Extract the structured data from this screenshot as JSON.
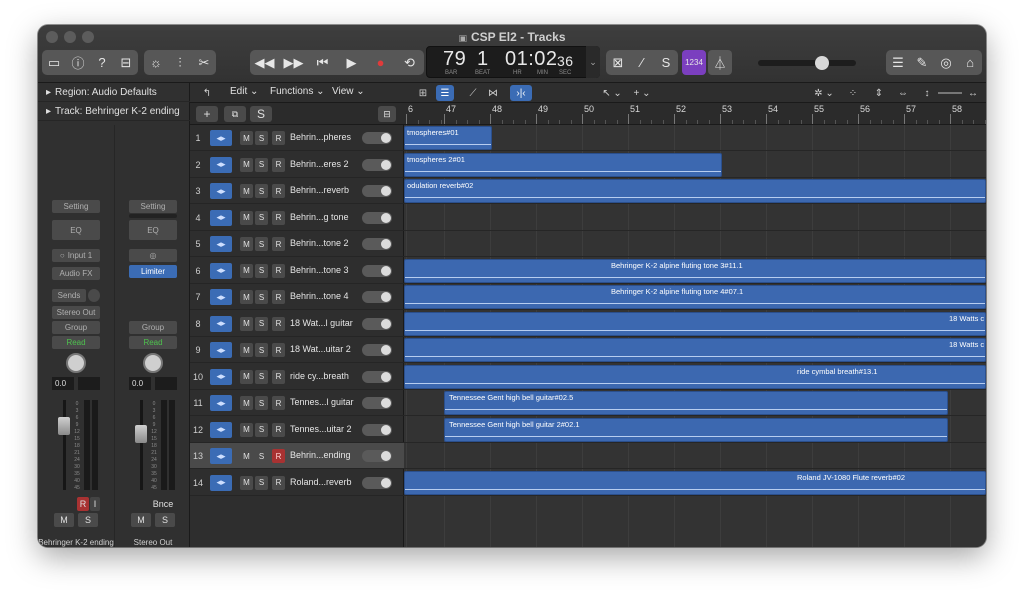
{
  "window": {
    "title": "CSP El2 - Tracks"
  },
  "lcd": {
    "bar": "79",
    "beat": "1",
    "time": "01:02",
    "sec": "36",
    "labels": [
      "BAR",
      "BEAT",
      "HR",
      "MIN",
      "SEC"
    ]
  },
  "key_badge": "1234",
  "inspector": {
    "region_label": "Region: Audio Defaults",
    "track_label": "Track:",
    "track_value": "Behringer K-2 ending",
    "strip1": {
      "setting": "Setting",
      "eq": "EQ",
      "input": "Input 1",
      "audio_fx": "Audio FX",
      "sends": "Sends",
      "output": "Stereo Out",
      "group": "Group",
      "automation": "Read",
      "pan_value": "0.0",
      "mute": "M",
      "solo": "S",
      "record": "R",
      "name": "Behringer K-2 ending"
    },
    "strip2": {
      "setting": "Setting",
      "eq": "EQ",
      "plugin": "Limiter",
      "group": "Group",
      "automation": "Read",
      "pan_value": "0.0",
      "bounce": "Bnce",
      "mute": "M",
      "solo": "S",
      "name": "Stereo Out"
    },
    "fader_scale": [
      "0",
      "3",
      "6",
      "9",
      "12",
      "15",
      "18",
      "21",
      "24",
      "30",
      "35",
      "40",
      "45",
      "50",
      "60"
    ]
  },
  "toolbar": {
    "edit": "Edit",
    "functions": "Functions",
    "view": "View"
  },
  "tracklist_header": {
    "add": "+",
    "solo_all": "S"
  },
  "tracks": [
    {
      "num": "1",
      "name": "Behrin...pheres",
      "mute": "M",
      "solo": "S",
      "record": "R"
    },
    {
      "num": "2",
      "name": "Behrin...eres 2",
      "mute": "M",
      "solo": "S",
      "record": "R"
    },
    {
      "num": "3",
      "name": "Behrin...reverb",
      "mute": "M",
      "solo": "S",
      "record": "R"
    },
    {
      "num": "4",
      "name": "Behrin...g tone",
      "mute": "M",
      "solo": "S",
      "record": "R"
    },
    {
      "num": "5",
      "name": "Behrin...tone 2",
      "mute": "M",
      "solo": "S",
      "record": "R"
    },
    {
      "num": "6",
      "name": "Behrin...tone 3",
      "mute": "M",
      "solo": "S",
      "record": "R"
    },
    {
      "num": "7",
      "name": "Behrin...tone 4",
      "mute": "M",
      "solo": "S",
      "record": "R"
    },
    {
      "num": "8",
      "name": "18 Wat...l guitar",
      "mute": "M",
      "solo": "S",
      "record": "R"
    },
    {
      "num": "9",
      "name": "18 Wat...uitar 2",
      "mute": "M",
      "solo": "S",
      "record": "R"
    },
    {
      "num": "10",
      "name": "ride cy...breath",
      "mute": "M",
      "solo": "S",
      "record": "R"
    },
    {
      "num": "11",
      "name": "Tennes...l guitar",
      "mute": "M",
      "solo": "S",
      "record": "R"
    },
    {
      "num": "12",
      "name": "Tennes...uitar 2",
      "mute": "M",
      "solo": "S",
      "record": "R"
    },
    {
      "num": "13",
      "name": "Behrin...ending",
      "mute": "M",
      "solo": "S",
      "record": "R"
    },
    {
      "num": "14",
      "name": "Roland...reverb",
      "mute": "M",
      "solo": "S",
      "record": "R"
    }
  ],
  "ruler": {
    "bars": [
      "6",
      "47",
      "48",
      "49",
      "50",
      "51",
      "52",
      "53",
      "54",
      "55",
      "56",
      "57",
      "58"
    ]
  },
  "regions": [
    {
      "label": "tmospheres#01"
    },
    {
      "label": "tmospheres 2#01"
    },
    {
      "label": "odulation reverb#02"
    },
    {
      "label": "Behringer K-2 alpine fluting tone 3#11.1"
    },
    {
      "label": "Behringer K-2 alpine fluting tone 4#07.1"
    },
    {
      "label": "18 Watts c"
    },
    {
      "label": "18 Watts c"
    },
    {
      "label": "ride cymbal breath#13.1"
    },
    {
      "label": "Tennessee Gent high bell guitar#02.5"
    },
    {
      "label": "Tennessee Gent high bell guitar 2#02.1"
    },
    {
      "label": "Roland JV-1080 Flute reverb#02"
    }
  ]
}
